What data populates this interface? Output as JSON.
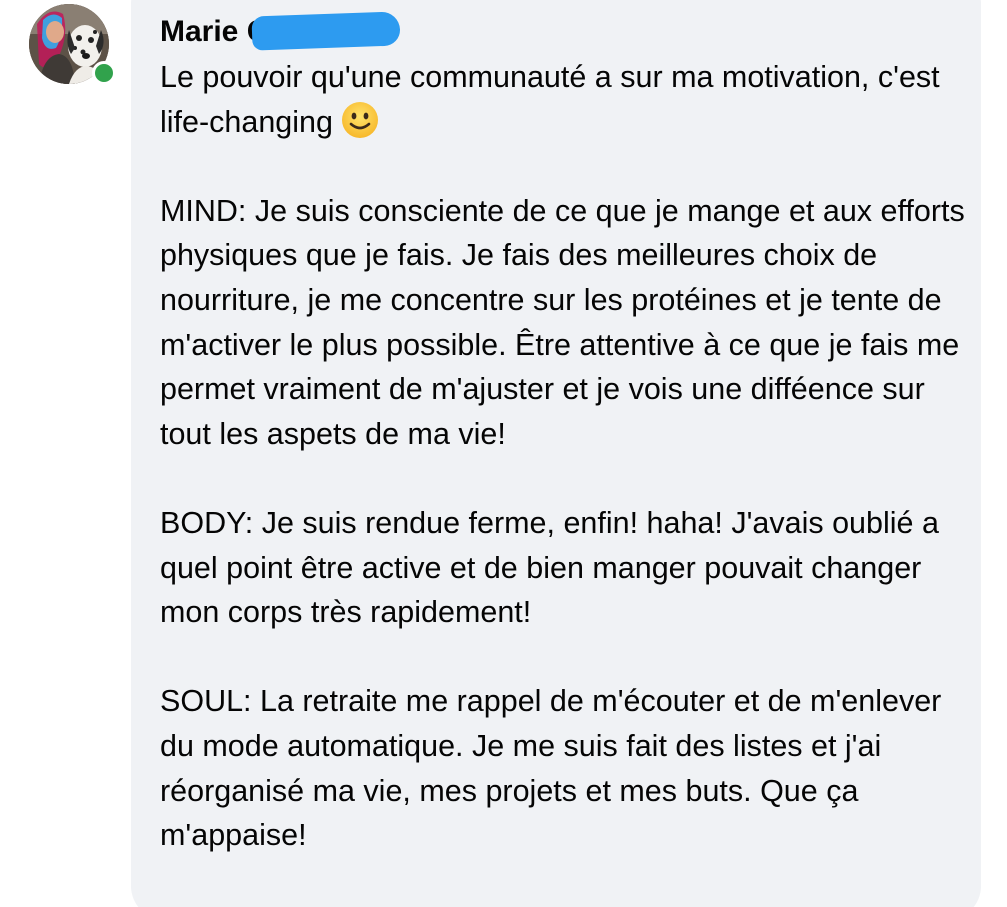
{
  "comment": {
    "author_name": "Marie C",
    "author_online": true,
    "colors": {
      "bubble_background": "#f0f2f5",
      "online_indicator": "#31a24c",
      "redaction_scribble": "#2d9bf0",
      "text": "#050505"
    },
    "paragraphs": [
      {
        "text": "Le pouvoir qu'une communauté a sur ma motivation, c'est life-changing",
        "trailing_emoji": "slightly-smiling-face-icon"
      },
      {
        "text": "MIND: Je suis consciente de ce que je mange et aux efforts physiques que je fais. Je fais des meilleures choix de nourriture, je me concentre sur les protéines et je tente de m'activer le plus possible. Être attentive à ce que je fais me permet vraiment de m'ajuster et je vois une difféence sur tout les aspets de ma vie!"
      },
      {
        "text": "BODY: Je suis rendue ferme, enfin! haha! J'avais oublié a quel point être active et de bien manger pouvait changer mon corps très rapidement!"
      },
      {
        "text": "SOUL: La retraite me rappel de m'écouter et de m'enlever du mode automatique. Je me suis fait des listes et j'ai réorganisé ma vie, mes projets et mes buts. Que ça m'appaise!"
      }
    ]
  }
}
